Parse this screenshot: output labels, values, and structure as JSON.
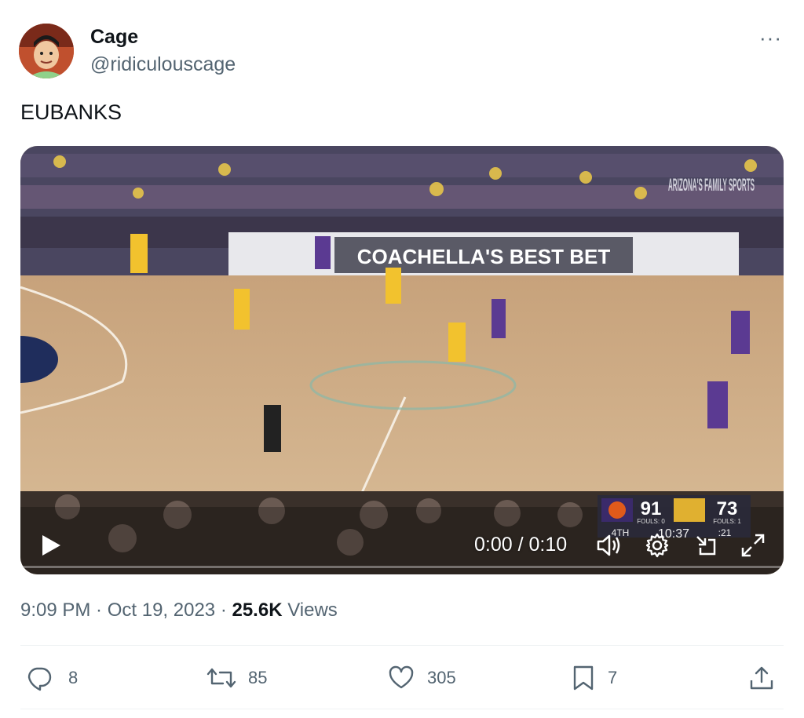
{
  "author": {
    "display_name": "Cage",
    "handle": "@ridiculouscage",
    "avatar_icon": "cartoon-avatar"
  },
  "more_icon_glyph": "···",
  "tweet": {
    "text": "EUBANKS"
  },
  "video": {
    "time_display": "0:00 / 0:10",
    "sponsor_banner": "COACHELLA'S BEST BET",
    "network_logo": "ARIZONA'S FAMILY SPORTS",
    "scorebug": {
      "home_score": "91",
      "away_score": "73",
      "home_fouls": "FOULS: 0",
      "away_fouls": "FOULS: 1",
      "quarter": "4TH",
      "clock": "10:37",
      "shot_clock": ":21"
    }
  },
  "meta": {
    "time": "9:09 PM",
    "separator": " · ",
    "date": "Oct 19, 2023",
    "views_count": "25.6K",
    "views_label": "Views"
  },
  "actions": {
    "replies": "8",
    "reposts": "85",
    "likes": "305",
    "bookmarks": "7"
  },
  "colors": {
    "text_primary": "#0f1419",
    "text_secondary": "#536471",
    "divider": "#eff3f4"
  }
}
